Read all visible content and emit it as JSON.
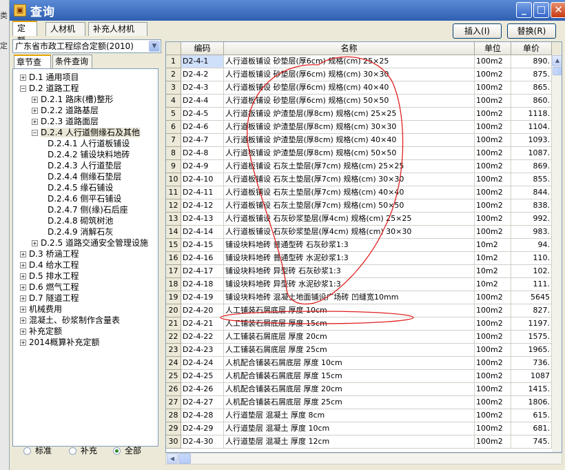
{
  "window": {
    "title": "查询",
    "app_icon": "app-icon",
    "bg_glyphs": [
      "类",
      "定"
    ]
  },
  "titlebar_buttons": {
    "minimize": "_",
    "maximize": "□",
    "close": "✕"
  },
  "tabs": [
    {
      "label": "定额"
    },
    {
      "label": "人材机"
    },
    {
      "label": "补充人材机"
    }
  ],
  "toolbar": {
    "insert_label": "插入(I)",
    "replace_label": "替换(R)"
  },
  "library": {
    "selected": "广东省市政工程综合定额(2010)"
  },
  "subtabs": [
    {
      "label": "章节查询"
    },
    {
      "label": "条件查询"
    }
  ],
  "tree": [
    {
      "label": "D.1 通用项目",
      "pm": "+"
    },
    {
      "label": "D.2 道路工程",
      "pm": "−"
    },
    {
      "label": "D.2.1 路床(槽)整形",
      "pm": "+"
    },
    {
      "label": "D.2.2 道路基层",
      "pm": "+"
    },
    {
      "label": "D.2.3 道路面层",
      "pm": "+"
    },
    {
      "label": "D.2.4 人行道侧缘石及其他",
      "pm": "−"
    },
    {
      "label": "D.2.4.1 人行道板铺设",
      "pm": ""
    },
    {
      "label": "D.2.4.2 铺设块料地砖",
      "pm": ""
    },
    {
      "label": "D.2.4.3 人行道垫层",
      "pm": ""
    },
    {
      "label": "D.2.4.4 侧缘石垫层",
      "pm": ""
    },
    {
      "label": "D.2.4.5 缘石铺设",
      "pm": ""
    },
    {
      "label": "D.2.4.6 侧平石铺设",
      "pm": ""
    },
    {
      "label": "D.2.4.7 侧(缘)石后座",
      "pm": ""
    },
    {
      "label": "D.2.4.8 砌筑树池",
      "pm": ""
    },
    {
      "label": "D.2.4.9 消解石灰",
      "pm": ""
    },
    {
      "label": "D.2.5 道路交通安全管理设施",
      "pm": "+"
    },
    {
      "label": "D.3 桥涵工程",
      "pm": "+"
    },
    {
      "label": "D.4 给水工程",
      "pm": "+"
    },
    {
      "label": "D.5 排水工程",
      "pm": "+"
    },
    {
      "label": "D.6 燃气工程",
      "pm": "+"
    },
    {
      "label": "D.7 隧道工程",
      "pm": "+"
    },
    {
      "label": "机械费用",
      "pm": "+"
    },
    {
      "label": "混凝土、砂浆制作含量表",
      "pm": "+"
    },
    {
      "label": "补充定额",
      "pm": "+"
    },
    {
      "label": "2014概算补充定额",
      "pm": "+"
    }
  ],
  "radios": [
    {
      "label": "标准",
      "checked": false
    },
    {
      "label": "补充",
      "checked": false
    },
    {
      "label": "全部",
      "checked": true
    }
  ],
  "grid": {
    "columns": [
      "编码",
      "名称",
      "单位",
      "单价"
    ],
    "rows": [
      [
        "1",
        "D2-4-1",
        "人行道板铺设 砂垫层(厚6cm) 规格(cm) 25×25",
        "100m2",
        "890."
      ],
      [
        "2",
        "D2-4-2",
        "人行道板铺设 砂垫层(厚6cm) 规格(cm) 30×30",
        "100m2",
        "875."
      ],
      [
        "3",
        "D2-4-3",
        "人行道板铺设 砂垫层(厚6cm) 规格(cm) 40×40",
        "100m2",
        "865."
      ],
      [
        "4",
        "D2-4-4",
        "人行道板铺设 砂垫层(厚6cm) 规格(cm) 50×50",
        "100m2",
        "860."
      ],
      [
        "5",
        "D2-4-5",
        "人行道板铺设 炉渣垫层(厚8cm) 规格(cm) 25×25",
        "100m2",
        "1118."
      ],
      [
        "6",
        "D2-4-6",
        "人行道板铺设 炉渣垫层(厚8cm) 规格(cm) 30×30",
        "100m2",
        "1104."
      ],
      [
        "7",
        "D2-4-7",
        "人行道板铺设 炉渣垫层(厚8cm) 规格(cm) 40×40",
        "100m2",
        "1093."
      ],
      [
        "8",
        "D2-4-8",
        "人行道板铺设 炉渣垫层(厚8cm) 规格(cm) 50×50",
        "100m2",
        "1087."
      ],
      [
        "9",
        "D2-4-9",
        "人行道板铺设 石灰土垫层(厚7cm) 规格(cm) 25×25",
        "100m2",
        "869."
      ],
      [
        "10",
        "D2-4-10",
        "人行道板铺设 石灰土垫层(厚7cm) 规格(cm) 30×30",
        "100m2",
        "855."
      ],
      [
        "11",
        "D2-4-11",
        "人行道板铺设 石灰土垫层(厚7cm) 规格(cm) 40×40",
        "100m2",
        "844."
      ],
      [
        "12",
        "D2-4-12",
        "人行道板铺设 石灰土垫层(厚7cm) 规格(cm) 50×50",
        "100m2",
        "838."
      ],
      [
        "13",
        "D2-4-13",
        "人行道板铺设 石灰砂浆垫层(厚4cm) 规格(cm) 25×25",
        "100m2",
        "992."
      ],
      [
        "14",
        "D2-4-14",
        "人行道板铺设 石灰砂浆垫层(厚4cm) 规格(cm) 30×30",
        "100m2",
        "983."
      ],
      [
        "15",
        "D2-4-15",
        "铺设块料地砖 普通型砖 石灰砂浆1:3",
        "10m2",
        "94."
      ],
      [
        "16",
        "D2-4-16",
        "铺设块料地砖 普通型砖 水泥砂浆1:3",
        "10m2",
        "110."
      ],
      [
        "17",
        "D2-4-17",
        "铺设块料地砖 异型砖 石灰砂浆1:3",
        "10m2",
        "102."
      ],
      [
        "18",
        "D2-4-18",
        "铺设块料地砖 异型砖 水泥砂浆1:3",
        "10m2",
        "111."
      ],
      [
        "19",
        "D2-4-19",
        "铺设块料地砖 混凝土地面铺设广场砖 凹缝宽10mm",
        "100m2",
        "5645"
      ],
      [
        "20",
        "D2-4-20",
        "人工铺装石屑底层 厚度 10cm",
        "100m2",
        "827."
      ],
      [
        "21",
        "D2-4-21",
        "人工铺装石屑底层 厚度 15cm",
        "100m2",
        "1197."
      ],
      [
        "22",
        "D2-4-22",
        "人工铺装石屑底层 厚度 20cm",
        "100m2",
        "1575."
      ],
      [
        "23",
        "D2-4-23",
        "人工铺装石屑底层 厚度 25cm",
        "100m2",
        "1965."
      ],
      [
        "24",
        "D2-4-24",
        "人机配合铺装石屑底层 厚度 10cm",
        "100m2",
        "736."
      ],
      [
        "25",
        "D2-4-25",
        "人机配合铺装石屑底层 厚度 15cm",
        "100m2",
        "1087"
      ],
      [
        "26",
        "D2-4-26",
        "人机配合铺装石屑底层 厚度 20cm",
        "100m2",
        "1415."
      ],
      [
        "27",
        "D2-4-27",
        "人机配合铺装石屑底层 厚度 25cm",
        "100m2",
        "1806."
      ],
      [
        "28",
        "D2-4-28",
        "人行道垫层 混凝土 厚度 8cm",
        "100m2",
        "615."
      ],
      [
        "29",
        "D2-4-29",
        "人行道垫层 混凝土 厚度 10cm",
        "100m2",
        "681."
      ],
      [
        "30",
        "D2-4-30",
        "人行道垫层 混凝土 厚度 12cm",
        "100m2",
        "745."
      ]
    ]
  },
  "colors": {
    "title_bar": "#2f5fb0",
    "annotation": "#e02020",
    "selected_cell": "#cfe0fb"
  }
}
